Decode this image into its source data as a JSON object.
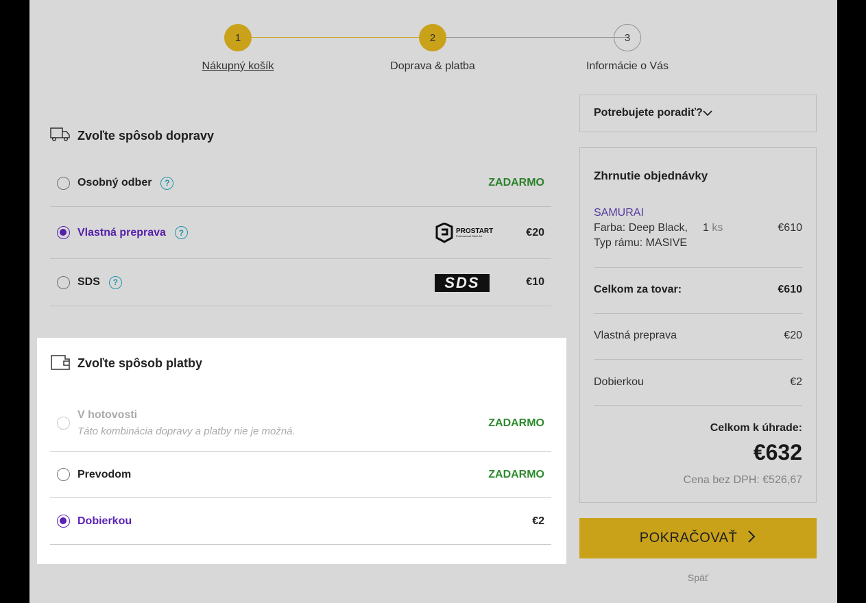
{
  "stepper": {
    "steps": [
      {
        "number": "1",
        "label": "Nákupný košík"
      },
      {
        "number": "2",
        "label": "Doprava & platba"
      },
      {
        "number": "3",
        "label": "Informácie o Vás"
      }
    ]
  },
  "shipping": {
    "title": "Zvoľte spôsob dopravy",
    "options": [
      {
        "label": "Osobný odber",
        "price": "ZADARMO",
        "selected": false
      },
      {
        "label": "Vlastná preprava",
        "price": "€20",
        "selected": true,
        "logo": "PROSTART",
        "logo_sub": "Professional Steel Art"
      },
      {
        "label": "SDS",
        "price": "€10",
        "selected": false,
        "logo": "SDS"
      }
    ]
  },
  "payment": {
    "title": "Zvoľte spôsob platby",
    "options": [
      {
        "label": "V hotovosti",
        "note": "Táto kombinácia dopravy a platby nie je možná.",
        "price": "ZADARMO",
        "disabled": true
      },
      {
        "label": "Prevodom",
        "price": "ZADARMO",
        "selected": false
      },
      {
        "label": "Dobierkou",
        "price": "€2",
        "selected": true
      }
    ]
  },
  "advice": {
    "label": "Potrebujete poradiť?"
  },
  "summary": {
    "title": "Zhrnutie objednávky",
    "product": {
      "name": "SAMURAI",
      "attr1": "Farba: Deep Black,",
      "attr2": "Typ rámu: MASIVE",
      "qty": "1",
      "qty_unit": "ks",
      "price": "€610"
    },
    "goods_total_label": "Celkom za tovar:",
    "goods_total": "€610",
    "shipping_label": "Vlastná preprava",
    "shipping_price": "€20",
    "payment_label": "Dobierkou",
    "payment_price": "€2",
    "total_label": "Celkom k úhrade:",
    "total": "€632",
    "net_label": "Cena bez DPH:",
    "net": "€526,67"
  },
  "actions": {
    "continue": "POKRAČOVAŤ",
    "back": "Späť"
  },
  "colors": {
    "accent": "#d6ad1c",
    "selected": "#5b21b6",
    "free": "#2e8b2e",
    "help": "#21a0b5"
  }
}
